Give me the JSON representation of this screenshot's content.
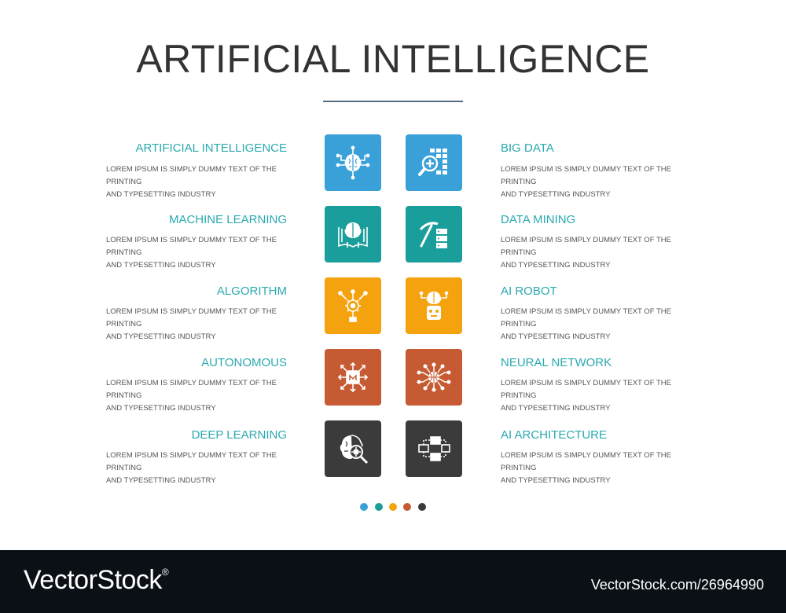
{
  "title": "ARTIFICIAL INTELLIGENCE",
  "colors": {
    "title": "#333333",
    "rule": "#5a6d80",
    "label": "#2aa9b0",
    "body_text": "#555555",
    "blue": "#3aa0d8",
    "teal": "#1a9e9b",
    "yellow": "#f5a20f",
    "orange": "#c65a32",
    "dark": "#3b3b3b",
    "footer_bg": "#0b1017"
  },
  "left_items": [
    {
      "title": "ARTIFICIAL INTELLIGENCE",
      "desc_line1": "LOREM IPSUM IS SIMPLY DUMMY TEXT OF THE PRINTING",
      "desc_line2": "AND TYPESETTING INDUSTRY",
      "icon": "brain-circuit-icon",
      "color": "#3aa0d8"
    },
    {
      "title": "MACHINE LEARNING",
      "desc_line1": "LOREM IPSUM IS SIMPLY DUMMY TEXT OF THE PRINTING",
      "desc_line2": "AND TYPESETTING INDUSTRY",
      "icon": "brain-book-icon",
      "color": "#1a9e9b"
    },
    {
      "title": "ALGORITHM",
      "desc_line1": "LOREM IPSUM IS SIMPLY DUMMY TEXT OF THE PRINTING",
      "desc_line2": "AND TYPESETTING INDUSTRY",
      "icon": "algorithm-gear-icon",
      "color": "#f5a20f"
    },
    {
      "title": "AUTONOMOUS",
      "desc_line1": "LOREM IPSUM IS SIMPLY DUMMY TEXT OF THE PRINTING",
      "desc_line2": "AND TYPESETTING INDUSTRY",
      "icon": "chip-arrows-icon",
      "color": "#c65a32"
    },
    {
      "title": "DEEP LEARNING",
      "desc_line1": "LOREM IPSUM IS SIMPLY DUMMY TEXT OF THE PRINTING",
      "desc_line2": "AND TYPESETTING INDUSTRY",
      "icon": "brain-search-icon",
      "color": "#3b3b3b"
    }
  ],
  "right_items": [
    {
      "title": "BIG DATA",
      "desc_line1": "LOREM IPSUM IS SIMPLY DUMMY TEXT OF THE PRINTING",
      "desc_line2": "AND TYPESETTING INDUSTRY",
      "icon": "data-grid-search-icon",
      "color": "#3aa0d8"
    },
    {
      "title": "DATA MINING",
      "desc_line1": "LOREM IPSUM IS SIMPLY DUMMY TEXT OF THE PRINTING",
      "desc_line2": "AND TYPESETTING INDUSTRY",
      "icon": "pickaxe-server-icon",
      "color": "#1a9e9b"
    },
    {
      "title": "AI ROBOT",
      "desc_line1": "LOREM IPSUM IS SIMPLY DUMMY TEXT OF THE PRINTING",
      "desc_line2": "AND TYPESETTING INDUSTRY",
      "icon": "robot-brain-icon",
      "color": "#f5a20f"
    },
    {
      "title": "NEURAL NETWORK",
      "desc_line1": "LOREM IPSUM IS SIMPLY DUMMY TEXT OF THE PRINTING",
      "desc_line2": "AND TYPESETTING INDUSTRY",
      "icon": "network-globe-icon",
      "color": "#c65a32"
    },
    {
      "title": "AI ARCHITECTURE",
      "desc_line1": "LOREM IPSUM IS SIMPLY DUMMY TEXT OF THE PRINTING",
      "desc_line2": "AND TYPESETTING INDUSTRY",
      "icon": "flowchart-icon",
      "color": "#3b3b3b"
    }
  ],
  "dots": [
    "#3aa0d8",
    "#1a9e9b",
    "#f5a20f",
    "#c65a32",
    "#3b3b3b"
  ],
  "footer": {
    "logo": "VectorStock",
    "registered": "®",
    "url": "VectorStock.com/26964990"
  }
}
